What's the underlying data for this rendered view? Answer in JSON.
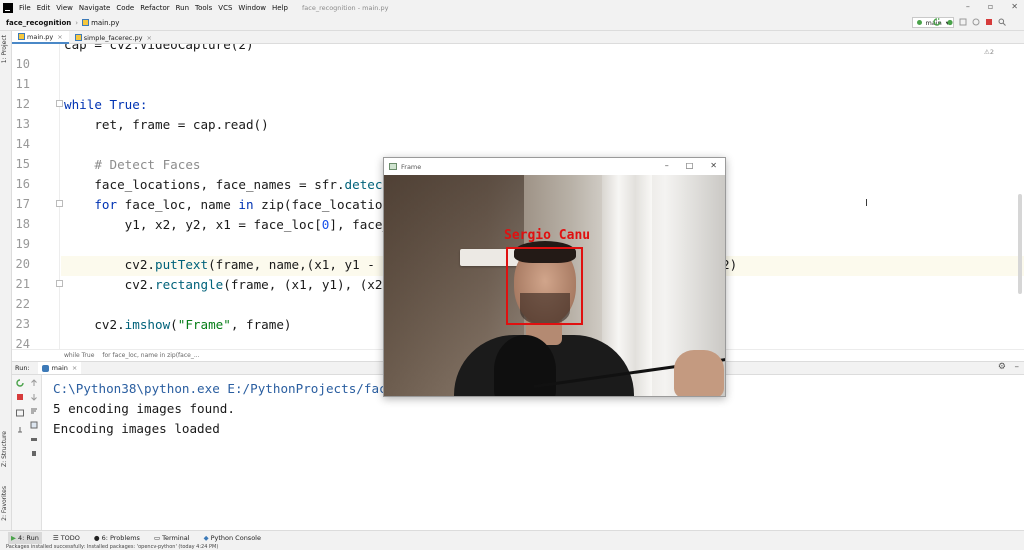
{
  "menubar": {
    "items": [
      "File",
      "Edit",
      "View",
      "Navigate",
      "Code",
      "Refactor",
      "Run",
      "Tools",
      "VCS",
      "Window",
      "Help"
    ],
    "title": "face_recognition - main.py"
  },
  "navbar": {
    "project": "face_recognition",
    "file": "main.py",
    "branch": "main"
  },
  "leftstrip": {
    "project_label": "1: Project",
    "structure_label": "Z: Structure",
    "favorites_label": "2: Favorites"
  },
  "tabs": [
    {
      "label": "main.py"
    },
    {
      "label": "simple_facerec.py"
    }
  ],
  "editor": {
    "warnings": "2",
    "lines": [
      {
        "no": "10"
      },
      {
        "no": "11"
      },
      {
        "no": "12"
      },
      {
        "no": "13"
      },
      {
        "no": "14"
      },
      {
        "no": "15"
      },
      {
        "no": "16"
      },
      {
        "no": "17"
      },
      {
        "no": "18"
      },
      {
        "no": "19"
      },
      {
        "no": "20"
      },
      {
        "no": "21"
      },
      {
        "no": "22"
      },
      {
        "no": "23"
      },
      {
        "no": "24"
      }
    ],
    "code": {
      "l9": "cap = cv2.VideoCapture(2)",
      "l12_kw": "while True:",
      "l13": "    ret, frame = cap.read()",
      "l15": "    # Detect Faces",
      "l16a": "    face_locations, face_names = sfr.",
      "l16b": "detect",
      "l17a": "    for",
      "l17b": " face_loc, name ",
      "l17c": "in",
      "l17d": " zip(face_location",
      "l18a": "        y1, x2, y2, x1 = face_loc[",
      "l18b": "0",
      "l18c": "], face_",
      "l20a": "        cv2.",
      "l20b": "putText",
      "l20c": "(frame, name,(x1, y1 - ",
      "l20d": "1",
      "l20tail": "2)",
      "l21a": "        cv2.",
      "l21b": "rectangle",
      "l21c": "(frame, (x1, y1), (x2,",
      "l23a": "    cv2.",
      "l23b": "imshow",
      "l23c": "(",
      "l23d": "\"Frame\"",
      "l23e": ", frame)"
    },
    "breadcrumb": [
      "while True",
      "for face_loc, name in zip(face_..."
    ]
  },
  "run": {
    "label": "Run:",
    "tab": "main",
    "console": [
      "C:\\Python38\\python.exe E:/PythonProjects/face",
      "5 encoding images found.",
      "Encoding images loaded"
    ]
  },
  "frame_window": {
    "title": "Frame",
    "detected_name": "Sergio Canu"
  },
  "bottomtabs": [
    {
      "label": "4: Run"
    },
    {
      "label": "TODO"
    },
    {
      "label": "6: Problems"
    },
    {
      "label": "Terminal"
    },
    {
      "label": "Python Console"
    }
  ],
  "statusbar": "Packages installed successfully: Installed packages: 'opencv-python' (today 4:24 PM)"
}
